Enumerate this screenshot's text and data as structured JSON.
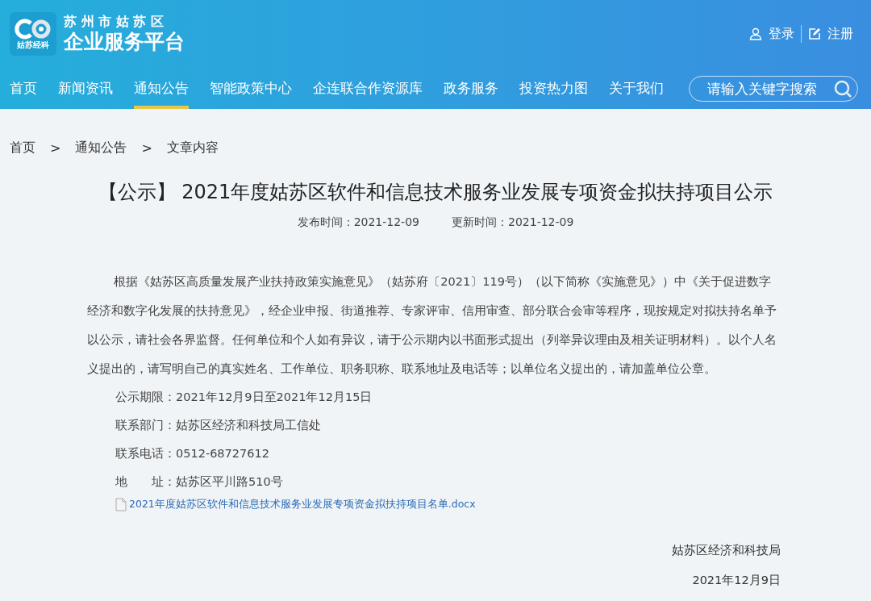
{
  "header": {
    "logo": {
      "caption": "姑苏经科"
    },
    "city": "苏 州 市 姑 苏 区",
    "platform": "企业服务平台",
    "login": "登录",
    "register": "注册"
  },
  "nav": {
    "items": [
      {
        "label": "首页",
        "selected": false
      },
      {
        "label": "新闻资讯",
        "selected": false
      },
      {
        "label": "通知公告",
        "selected": true
      },
      {
        "label": "智能政策中心",
        "selected": false
      },
      {
        "label": "企连联合作资源库",
        "selected": false
      },
      {
        "label": "政务服务",
        "selected": false
      },
      {
        "label": "投资热力图",
        "selected": false
      },
      {
        "label": "关于我们",
        "selected": false
      }
    ],
    "search": {
      "placeholder": "请输入关键字搜索"
    }
  },
  "breadcrumb": [
    "首页",
    "通知公告",
    "文章内容"
  ],
  "breadcrumb_separator": ">",
  "article": {
    "title": "【公示】 2021年度姑苏区软件和信息技术服务业发展专项资金拟扶持项目公示",
    "published": "发布时间：2021-12-09",
    "updated": "更新时间：2021-12-09",
    "body": "根据《姑苏区高质量发展产业扶持政策实施意见》（姑苏府〔2021〕119号）（以下简称《实施意见》）中《关于促进数字经济和数字化发展的扶持意见》，经企业申报、街道推荐、专家评审、信用审查、部分联合会审等程序，现按规定对拟扶持名单予以公示，请社会各界监督。任何单位和个人如有异议，请于公示期内以书面形式提出（列举异议理由及相关证明材料）。以个人名义提出的，请写明自己的真实姓名、工作单位、职务职称、联系地址及电话等；以单位名义提出的，请加盖单位公章。",
    "details": [
      "公示期限：2021年12月9日至2021年12月15日",
      "联系部门：姑苏区经济和科技局工信处",
      "联系电话：0512-68727612",
      "地　　址：姑苏区平川路510号"
    ],
    "attachment": "2021年度姑苏区软件和信息技术服务业发展专项资金拟扶持项目名单.docx",
    "signature": [
      "姑苏区经济和科技局",
      "2021年12月9日"
    ]
  }
}
